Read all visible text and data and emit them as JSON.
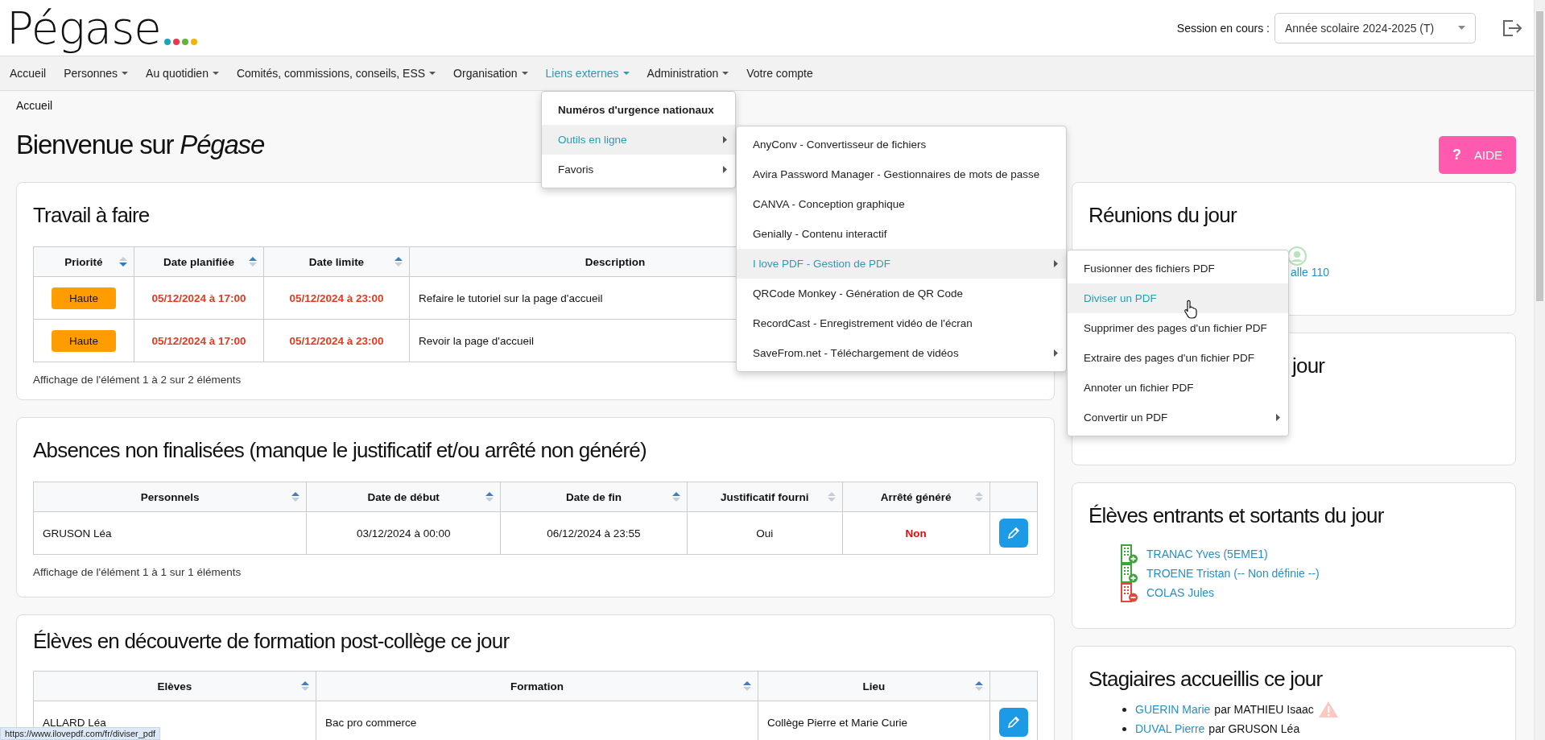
{
  "header": {
    "logo": "Pégase",
    "session_label": "Session en cours :",
    "session_value": "Année scolaire 2024-2025 (T)"
  },
  "nav": [
    {
      "label": "Accueil",
      "dropdown": false,
      "selected": false
    },
    {
      "label": "Personnes",
      "dropdown": true,
      "selected": false
    },
    {
      "label": "Au quotidien",
      "dropdown": true,
      "selected": false
    },
    {
      "label": "Comités, commissions, conseils, ESS",
      "dropdown": true,
      "selected": false
    },
    {
      "label": "Organisation",
      "dropdown": true,
      "selected": false
    },
    {
      "label": "Liens externes",
      "dropdown": true,
      "selected": true
    },
    {
      "label": "Administration",
      "dropdown": true,
      "selected": false
    },
    {
      "label": "Votre compte",
      "dropdown": false,
      "selected": false
    }
  ],
  "breadcrumb": "Accueil",
  "page_title": "Bienvenue sur *Pégase*",
  "help_button": {
    "icon": "?",
    "label": "AIDE"
  },
  "travail": {
    "title": "Travail à faire",
    "columns": [
      {
        "label": "Priorité",
        "sorted": true
      },
      {
        "label": "Date planifiée",
        "sorted": false
      },
      {
        "label": "Date limite",
        "sorted": false
      },
      {
        "label": "Description"
      }
    ],
    "rows": [
      {
        "priority": "Haute",
        "planned": "05/12/2024 à 17:00",
        "deadline": "05/12/2024 à 23:00",
        "description": "Refaire le tutoriel sur la page d'accueil"
      },
      {
        "priority": "Haute",
        "planned": "05/12/2024 à 17:00",
        "deadline": "05/12/2024 à 23:00",
        "description": "Revoir la page d'accueil"
      }
    ],
    "footer": "Affichage de l'élément 1 à 2 sur 2 éléments"
  },
  "absences": {
    "title": "Absences non finalisées (manque le justificatif et/ou arrêté non généré)",
    "columns": [
      {
        "label": "Personnels",
        "sorted": false
      },
      {
        "label": "Date de début",
        "sorted": false
      },
      {
        "label": "Date de fin",
        "sorted": false
      },
      {
        "label": "Justificatif fourni",
        "sorted": false
      },
      {
        "label": "Arrêté généré",
        "sorted": false
      }
    ],
    "rows": [
      {
        "person": "GRUSON Léa",
        "start": "03/12/2024 à 00:00",
        "end": "06/12/2024 à 23:55",
        "justificatif": "Oui",
        "arrete": "Non",
        "arrete_generated": false
      }
    ],
    "footer": "Affichage de l'élément 1 à 1 sur 1 éléments"
  },
  "decouverte": {
    "title": "Élèves en découverte de formation post-collège ce jour",
    "columns": [
      {
        "label": "Elèves",
        "sorted": false
      },
      {
        "label": "Formation",
        "sorted": false
      },
      {
        "label": "Lieu",
        "sorted": false
      }
    ],
    "rows": [
      {
        "eleve": "ALLARD Léa",
        "formation": "Bac pro commerce",
        "lieu": "Collège Pierre et Marie Curie"
      }
    ]
  },
  "reunions": {
    "title": "Réunions du jour",
    "fragment": "alle 110"
  },
  "card_jour": {
    "title_fragment": "jour"
  },
  "mouvements": {
    "title": "Élèves entrants et sortants du jour",
    "items": [
      {
        "kind": "entrant",
        "name": "TRANAC Yves (5EME1)"
      },
      {
        "kind": "entrant",
        "name": "TROENE Tristan (-- Non définie --)"
      },
      {
        "kind": "sortant",
        "name": "COLAS Jules"
      }
    ]
  },
  "stagiaires": {
    "title": "Stagiaires accueillis ce jour",
    "items": [
      {
        "name": "GUERIN Marie",
        "tutor": "par MATHIEU Isaac",
        "warning": true
      },
      {
        "name": "DUVAL Pierre",
        "tutor": "par GRUSON Léa",
        "warning": false
      }
    ]
  },
  "menu": [
    {
      "label": "Numéros d'urgence nationaux",
      "kind": "heading",
      "selected": false,
      "has_submenu": false
    },
    {
      "label": "Outils en ligne",
      "kind": "item",
      "selected": true,
      "has_submenu": true
    },
    {
      "label": "Favoris",
      "kind": "item",
      "selected": false,
      "has_submenu": true
    }
  ],
  "submenu": [
    {
      "label": "AnyConv - Convertisseur de fichiers",
      "selected": false,
      "has_submenu": false
    },
    {
      "label": "Avira Password Manager - Gestionnaires de mots de passe",
      "selected": false,
      "has_submenu": false
    },
    {
      "label": "CANVA - Conception graphique",
      "selected": false,
      "has_submenu": false
    },
    {
      "label": "Genially - Contenu interactif",
      "selected": false,
      "has_submenu": false
    },
    {
      "label": "I love PDF - Gestion de PDF",
      "selected": true,
      "has_submenu": true
    },
    {
      "label": "QRCode Monkey - Génération de QR Code",
      "selected": false,
      "has_submenu": false
    },
    {
      "label": "RecordCast - Enregistrement vidéo de l'écran",
      "selected": false,
      "has_submenu": false
    },
    {
      "label": "SaveFrom.net - Téléchargement de vidéos",
      "selected": false,
      "has_submenu": true
    }
  ],
  "submenu2": [
    {
      "label": "Fusionner des fichiers PDF",
      "selected": false,
      "has_submenu": false
    },
    {
      "label": "Diviser un PDF",
      "selected": true,
      "has_submenu": false
    },
    {
      "label": "Supprimer des pages d'un fichier PDF",
      "selected": false,
      "has_submenu": false
    },
    {
      "label": "Extraire des pages d'un fichier PDF",
      "selected": false,
      "has_submenu": false
    },
    {
      "label": "Annoter un fichier PDF",
      "selected": false,
      "has_submenu": false
    },
    {
      "label": "Convertir un PDF",
      "selected": false,
      "has_submenu": true
    }
  ],
  "status_url": "https://www.ilovepdf.com/fr/diviser_pdf"
}
